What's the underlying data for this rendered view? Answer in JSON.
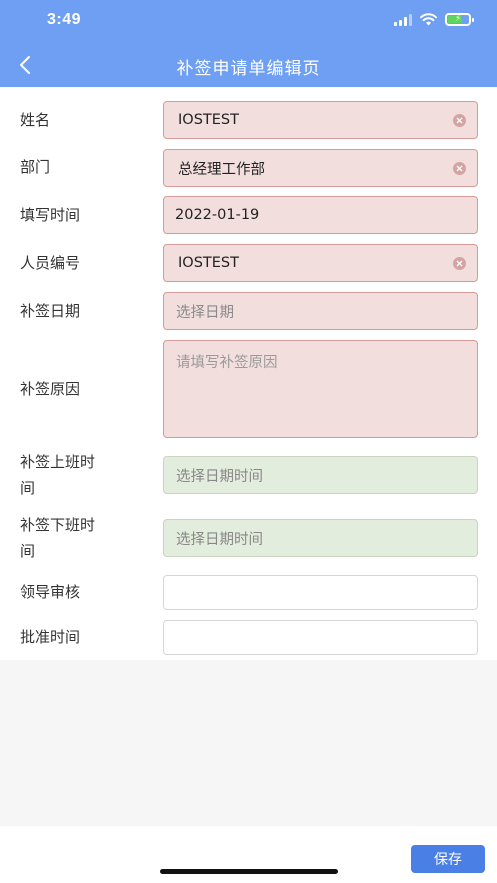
{
  "status_bar": {
    "time": "3:49"
  },
  "header": {
    "title": "补签申请单编辑页"
  },
  "form": {
    "name_label": "姓名",
    "name_value": "IOSTEST",
    "dept_label": "部门",
    "dept_value": "总经理工作部",
    "fill_time_label": "填写时间",
    "fill_time_value": "2022-01-19",
    "emp_no_label": "人员编号",
    "emp_no_value": "IOSTEST",
    "sign_date_label": "补签日期",
    "sign_date_placeholder": "选择日期",
    "reason_label": "补签原因",
    "reason_placeholder": "请填写补签原因",
    "checkin_label_line1": "补签上班时",
    "checkin_label_line2": "间",
    "checkin_placeholder": "选择日期时间",
    "checkout_label_line1": "补签下班时",
    "checkout_label_line2": "间",
    "checkout_placeholder": "选择日期时间",
    "approver_label": "领导审核",
    "approval_time_label": "批准时间"
  },
  "footer": {
    "save_label": "保存"
  },
  "colors": {
    "header": "#6f9ff2",
    "primary_button": "#4a7fe6",
    "required_field": "#f3dede",
    "datetime_field": "#e3eddd"
  }
}
